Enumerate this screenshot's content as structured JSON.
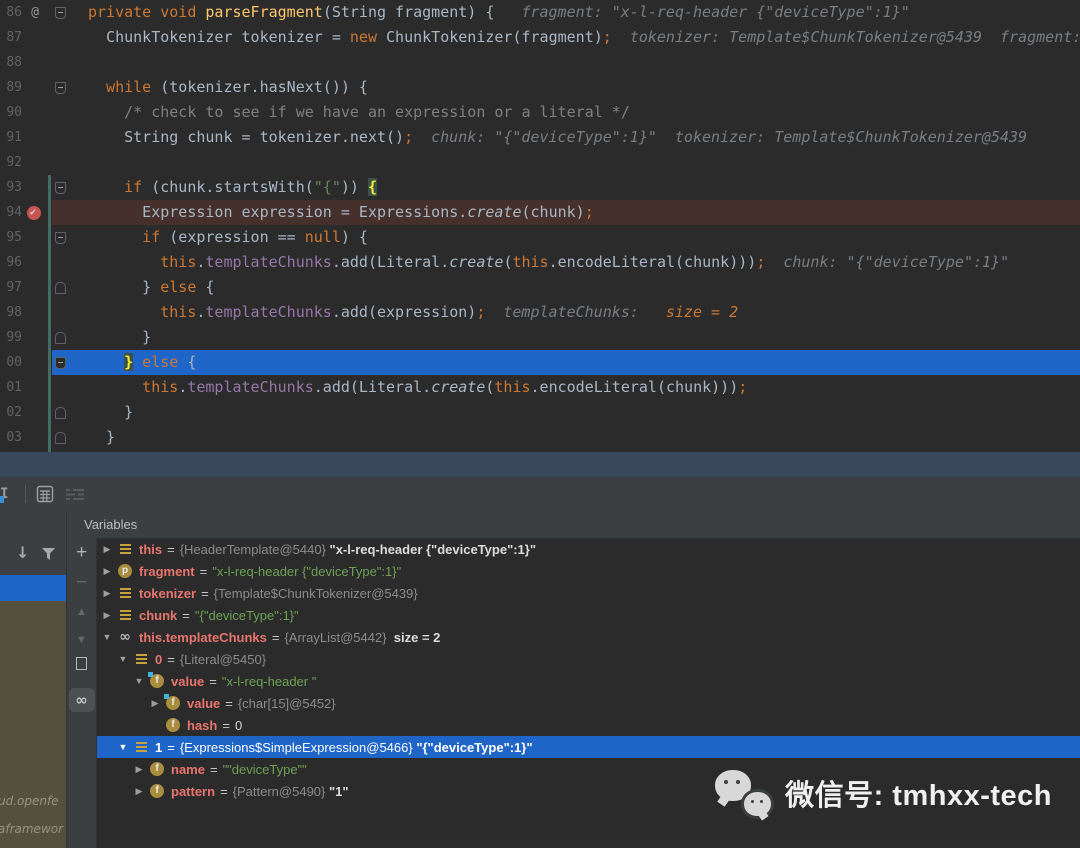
{
  "editor": {
    "lines": [
      {
        "num": "86",
        "g": "at",
        "fold": "open",
        "hl": "",
        "seg": [
          [
            "kw",
            "private void "
          ],
          [
            "method",
            "parseFragment"
          ],
          [
            "plain",
            "(String fragment) { "
          ]
        ],
        "hint": [
          [
            "hint",
            "fragment: \"x-l-req-header {\"deviceType\":1}\""
          ]
        ]
      },
      {
        "num": "87",
        "g": "",
        "fold": "",
        "hl": "",
        "seg": [
          [
            "plain",
            "  ChunkTokenizer tokenizer = "
          ],
          [
            "kw",
            "new"
          ],
          [
            "plain",
            " ChunkTokenizer(fragment)"
          ],
          [
            "semi",
            ";"
          ]
        ],
        "hint": [
          [
            "hint",
            "tokenizer: Template$ChunkTokenizer@5439"
          ],
          [
            "hint",
            "fragment: \"x-l-req-header {\"d"
          ]
        ]
      },
      {
        "num": "88",
        "g": "",
        "fold": "",
        "hl": "",
        "seg": [],
        "hint": []
      },
      {
        "num": "89",
        "g": "",
        "fold": "open",
        "hl": "",
        "seg": [
          [
            "kw",
            "  while"
          ],
          [
            "plain",
            " (tokenizer.hasNext()) {"
          ]
        ],
        "hint": []
      },
      {
        "num": "90",
        "g": "",
        "fold": "",
        "hl": "",
        "seg": [
          [
            "comment",
            "    /* check to see if we have an expression or a literal */"
          ]
        ],
        "hint": []
      },
      {
        "num": "91",
        "g": "",
        "fold": "",
        "hl": "",
        "seg": [
          [
            "plain",
            "    String chunk = tokenizer.next()"
          ],
          [
            "semi",
            ";"
          ]
        ],
        "hint": [
          [
            "hint",
            "chunk: \"{\"deviceType\":1}\""
          ],
          [
            "hint",
            "tokenizer: Template$ChunkTokenizer@5439"
          ]
        ]
      },
      {
        "num": "92",
        "g": "",
        "fold": "",
        "hl": "",
        "seg": [],
        "hint": []
      },
      {
        "num": "93",
        "g": "",
        "fold": "open",
        "hl": "",
        "seg": [
          [
            "kw",
            "    if"
          ],
          [
            "plain",
            " (chunk.startsWith("
          ],
          [
            "str",
            "\"{\""
          ],
          [
            "plain",
            ")) "
          ],
          [
            "match",
            "{"
          ]
        ],
        "hint": []
      },
      {
        "num": "94",
        "g": "bp",
        "fold": "",
        "hl": "red",
        "seg": [
          [
            "plain",
            "      Expression expression = Expressions."
          ],
          [
            "fni",
            "create"
          ],
          [
            "plain",
            "(chunk)"
          ],
          [
            "semi",
            ";"
          ]
        ],
        "hint": []
      },
      {
        "num": "95",
        "g": "",
        "fold": "open",
        "hl": "",
        "seg": [
          [
            "kw",
            "      if"
          ],
          [
            "plain",
            " (expression == "
          ],
          [
            "kw",
            "null"
          ],
          [
            "plain",
            ") {"
          ]
        ],
        "hint": []
      },
      {
        "num": "96",
        "g": "",
        "fold": "",
        "hl": "",
        "seg": [
          [
            "kw",
            "        this"
          ],
          [
            "plain",
            "."
          ],
          [
            "field",
            "templateChunks"
          ],
          [
            "plain",
            ".add(Literal."
          ],
          [
            "fni",
            "create"
          ],
          [
            "plain",
            "("
          ],
          [
            "kw",
            "this"
          ],
          [
            "plain",
            ".encodeLiteral(chunk)))"
          ],
          [
            "semi",
            ";"
          ]
        ],
        "hint": [
          [
            "hint",
            "chunk: \"{\"deviceType\":1}\""
          ]
        ]
      },
      {
        "num": "97",
        "g": "",
        "fold": "end",
        "hl": "",
        "seg": [
          [
            "plain",
            "      } "
          ],
          [
            "kw",
            "else"
          ],
          [
            "plain",
            " {"
          ]
        ],
        "hint": []
      },
      {
        "num": "98",
        "g": "",
        "fold": "",
        "hl": "",
        "seg": [
          [
            "kw",
            "        this"
          ],
          [
            "plain",
            "."
          ],
          [
            "field",
            "templateChunks"
          ],
          [
            "plain",
            ".add(expression)"
          ],
          [
            "semi",
            ";"
          ]
        ],
        "hint": [
          [
            "hint",
            "templateChunks: "
          ],
          [
            "hinto",
            "size = 2"
          ]
        ]
      },
      {
        "num": "99",
        "g": "",
        "fold": "end",
        "hl": "",
        "seg": [
          [
            "plain",
            "      }"
          ]
        ],
        "hint": []
      },
      {
        "num": "00",
        "g": "",
        "fold": "open",
        "hl": "blue",
        "seg": [
          [
            "plain",
            "    "
          ],
          [
            "match",
            "}"
          ],
          [
            "kw",
            " else"
          ],
          [
            "plain",
            " {"
          ]
        ],
        "hint": []
      },
      {
        "num": "01",
        "g": "",
        "fold": "",
        "hl": "",
        "seg": [
          [
            "kw",
            "      this"
          ],
          [
            "plain",
            "."
          ],
          [
            "field",
            "templateChunks"
          ],
          [
            "plain",
            ".add(Literal."
          ],
          [
            "fni",
            "create"
          ],
          [
            "plain",
            "("
          ],
          [
            "kw",
            "this"
          ],
          [
            "plain",
            ".encodeLiteral(chunk)))"
          ],
          [
            "semi",
            ";"
          ]
        ],
        "hint": []
      },
      {
        "num": "02",
        "g": "",
        "fold": "end",
        "hl": "",
        "seg": [
          [
            "plain",
            "    }"
          ]
        ],
        "hint": []
      },
      {
        "num": "03",
        "g": "",
        "fold": "end",
        "hl": "",
        "seg": [
          [
            "plain",
            "  }"
          ]
        ],
        "hint": []
      }
    ]
  },
  "variables": {
    "title": "Variables",
    "rows": [
      {
        "ind": 0,
        "ar": "r",
        "ic": "bars",
        "name": "this",
        "sel": false,
        "parts": [
          [
            "ref",
            "{HeaderTemplate@5440} "
          ],
          [
            "vbold",
            "\"x-l-req-header {\"deviceType\":1}\""
          ]
        ]
      },
      {
        "ind": 0,
        "ar": "r",
        "ic": "p",
        "name": "fragment",
        "sel": false,
        "parts": [
          [
            "vstr",
            "\"x-l-req-header {\"deviceType\":1}\""
          ]
        ]
      },
      {
        "ind": 0,
        "ar": "r",
        "ic": "bars",
        "name": "tokenizer",
        "sel": false,
        "parts": [
          [
            "ref",
            "{Template$ChunkTokenizer@5439}"
          ]
        ]
      },
      {
        "ind": 0,
        "ar": "r",
        "ic": "bars",
        "name": "chunk",
        "sel": false,
        "parts": [
          [
            "vstr",
            "\"{\"deviceType\":1}\""
          ]
        ]
      },
      {
        "ind": 0,
        "ar": "d",
        "ic": "watch",
        "name": "this.templateChunks",
        "sel": false,
        "parts": [
          [
            "ref",
            "{ArrayList@5442}  "
          ],
          [
            "vbold",
            "size = 2"
          ]
        ]
      },
      {
        "ind": 1,
        "ar": "d",
        "ic": "bars",
        "name": "0",
        "sel": false,
        "parts": [
          [
            "ref",
            "{Literal@5450}"
          ]
        ]
      },
      {
        "ind": 2,
        "ar": "d",
        "ic": "fd",
        "name": "value",
        "sel": false,
        "parts": [
          [
            "vstr",
            "\"x-l-req-header \""
          ]
        ]
      },
      {
        "ind": 3,
        "ar": "r",
        "ic": "fd",
        "name": "value",
        "sel": false,
        "parts": [
          [
            "ref",
            "{char[15]@5452}"
          ]
        ]
      },
      {
        "ind": 3,
        "ar": "",
        "ic": "f",
        "name": "hash",
        "sel": false,
        "parts": [
          [
            "vplain",
            "0"
          ]
        ]
      },
      {
        "ind": 1,
        "ar": "d",
        "ic": "bars",
        "name": "1",
        "sel": true,
        "parts": [
          [
            "ref",
            "{Expressions$SimpleExpression@5466} "
          ],
          [
            "vbold",
            "\"{\"deviceType\":1}\""
          ]
        ]
      },
      {
        "ind": 2,
        "ar": "r",
        "ic": "f",
        "name": "name",
        "sel": false,
        "parts": [
          [
            "vstr",
            "\"\"deviceType\"\""
          ]
        ]
      },
      {
        "ind": 2,
        "ar": "r",
        "ic": "f",
        "name": "pattern",
        "sel": false,
        "parts": [
          [
            "ref",
            "{Pattern@5490} "
          ],
          [
            "vbold",
            "\"1\""
          ]
        ]
      }
    ]
  },
  "frames": {
    "clipped_texts": [
      "ud.openfe",
      "aframewor"
    ]
  },
  "debug_toolbar": {
    "icons": [
      "text-cursor",
      "evaluate-expression",
      "layout"
    ]
  },
  "rail_buttons": [
    "add-watch",
    "remove-watch",
    "move-up",
    "move-down",
    "copy-value",
    "show-watches"
  ],
  "watermark": {
    "text": "微信号: tmhxx-tech"
  },
  "colors": {
    "editor_bg": "#2b2b2b",
    "panel_bg": "#3c3f41",
    "selection_blue": "#1f65c8",
    "breakpoint_red": "#c75450",
    "breakpoint_line_bg": "#45302b",
    "splitter_band": "#39485a",
    "frames_olive": "#55503d",
    "keyword_orange": "#cc7832",
    "string_green": "#6a8759",
    "field_purple": "#9876aa",
    "variable_name_salmon": "#e8756e",
    "vcs_change_teal": "#446b64"
  }
}
